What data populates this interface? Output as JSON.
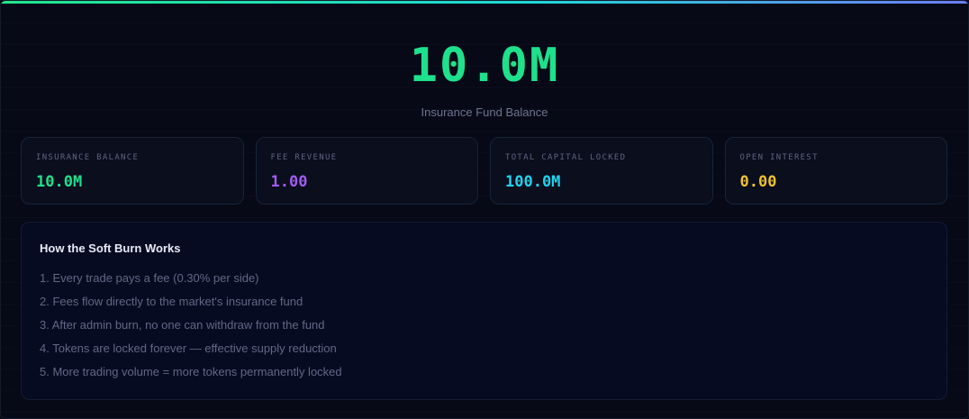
{
  "hero": {
    "value": "10.0M",
    "label": "Insurance Fund Balance"
  },
  "stats": [
    {
      "label": "INSURANCE BALANCE",
      "value": "10.0M",
      "color": "#1fe08c"
    },
    {
      "label": "FEE REVENUE",
      "value": "1.00",
      "color": "#a35cf0"
    },
    {
      "label": "TOTAL CAPITAL LOCKED",
      "value": "100.0M",
      "color": "#22d3ee"
    },
    {
      "label": "OPEN INTEREST",
      "value": "0.00",
      "color": "#f2c12e"
    }
  ],
  "info": {
    "title": "How the Soft Burn Works",
    "items": [
      "1. Every trade pays a fee (0.30% per side)",
      "2. Fees flow directly to the market's insurance fund",
      "3. After admin burn, no one can withdraw from the fund",
      "4. Tokens are locked forever — effective supply reduction",
      "5. More trading volume = more tokens permanently locked"
    ]
  }
}
